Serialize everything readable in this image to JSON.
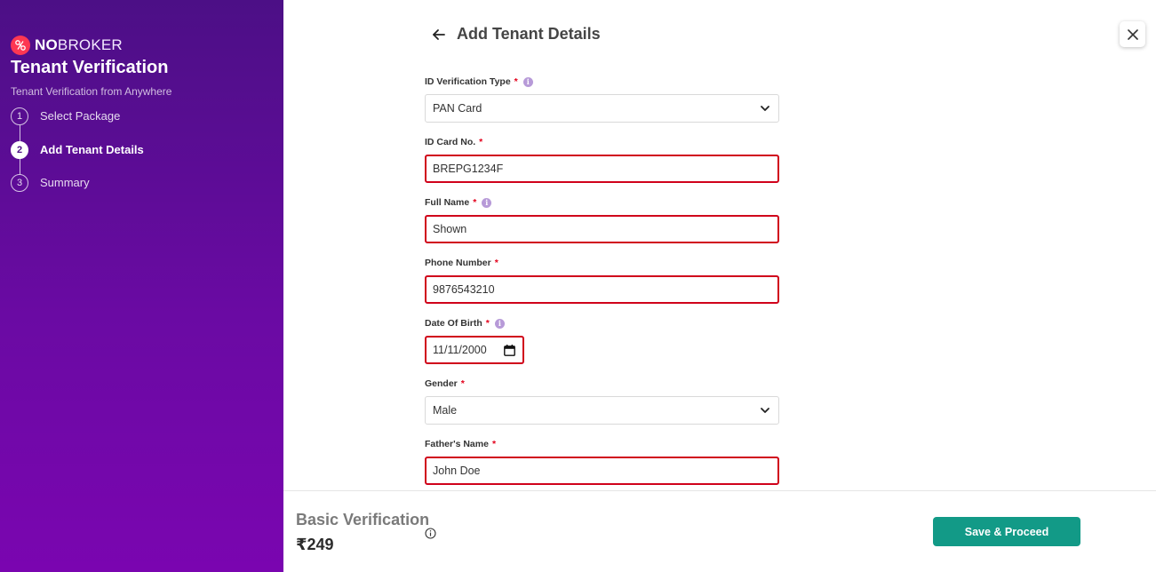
{
  "sidebar": {
    "brand_bold": "NO",
    "brand_rest": "BROKER",
    "title": "Tenant Verification",
    "subtitle": "Tenant Verification from Anywhere",
    "steps": [
      {
        "num": "1",
        "label": "Select Package"
      },
      {
        "num": "2",
        "label": "Add Tenant Details"
      },
      {
        "num": "3",
        "label": "Summary"
      }
    ],
    "active_step": 2
  },
  "header": {
    "title": "Add Tenant Details",
    "back_icon": "arrow-left-icon",
    "close_icon": "close-icon"
  },
  "form": {
    "id_type": {
      "label": "ID Verification Type",
      "required": "*",
      "value": "PAN Card"
    },
    "id_card_no": {
      "label": "ID Card No.",
      "required": "*",
      "value": "BREPG1234F"
    },
    "full_name": {
      "label": "Full Name",
      "required": "*",
      "value": "Shown"
    },
    "phone": {
      "label": "Phone Number",
      "required": "*",
      "value": "9876543210"
    },
    "dob": {
      "label": "Date Of Birth",
      "required": "*",
      "value": "11/11/2000"
    },
    "gender": {
      "label": "Gender",
      "required": "*",
      "value": "Male"
    },
    "father_name": {
      "label": "Father's Name",
      "required": "*",
      "value": "John Doe"
    }
  },
  "footer": {
    "plan_name": "Basic Verification",
    "price": "₹249",
    "proceed_label": "Save & Proceed"
  },
  "colors": {
    "sidebar_top": "#4c0f86",
    "sidebar_bottom": "#7a05b0",
    "brand_red": "#fd3752",
    "error_border": "#d0021b",
    "primary_button": "#129a87"
  }
}
